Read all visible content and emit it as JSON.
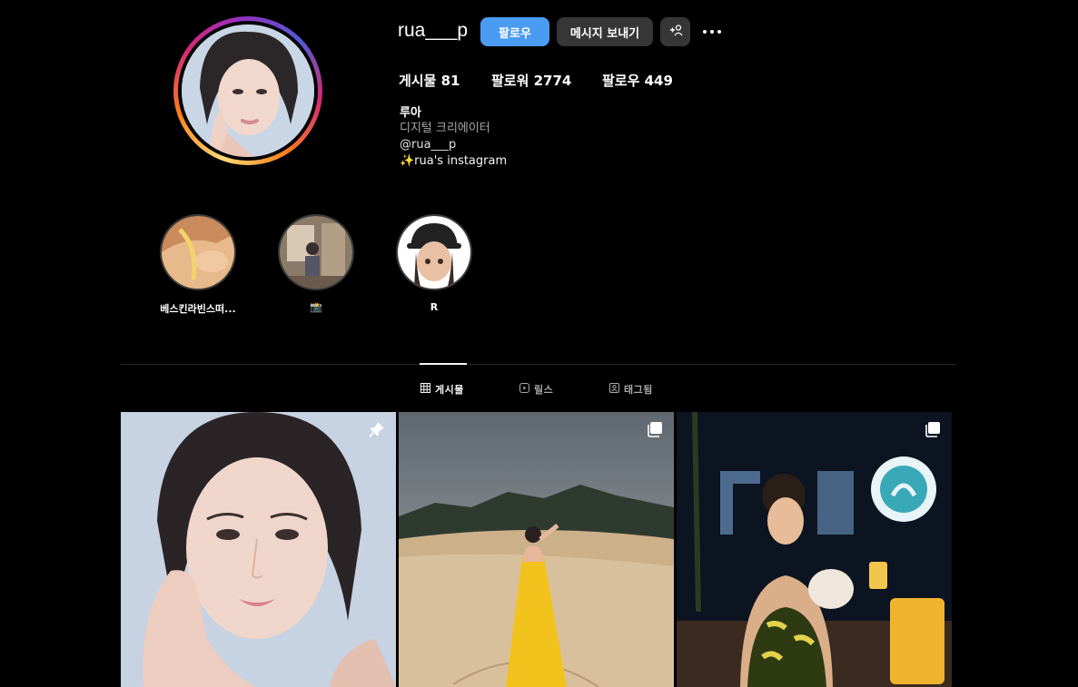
{
  "profile": {
    "username": "rua___p",
    "follow_label": "팔로우",
    "message_label": "메시지 보내기",
    "suggest_label": "+옷",
    "more_label": "•••"
  },
  "stats": {
    "posts": "게시물 81",
    "followers": "팔로워 2774",
    "following": "팔로우 449"
  },
  "bio": {
    "name": "루아",
    "category": "디지털 크리에이터",
    "handle": "@rua___p",
    "text": "✨rua's instagram"
  },
  "highlights": [
    {
      "label": "베스킨라빈스떠..."
    },
    {
      "label": "📸"
    },
    {
      "label": "R"
    }
  ],
  "tabs": [
    {
      "label": "게시물",
      "icon": "grid-icon",
      "active": true
    },
    {
      "label": "릴스",
      "icon": "reels-icon",
      "active": false
    },
    {
      "label": "태그됨",
      "icon": "tagged-icon",
      "active": false
    }
  ],
  "posts": [
    {
      "badge": "pin-icon"
    },
    {
      "badge": "carousel-icon"
    },
    {
      "badge": "carousel-icon"
    }
  ],
  "colors": {
    "background": "#000000",
    "follow_button": "#4a9cf3",
    "secondary_button": "#363636"
  }
}
